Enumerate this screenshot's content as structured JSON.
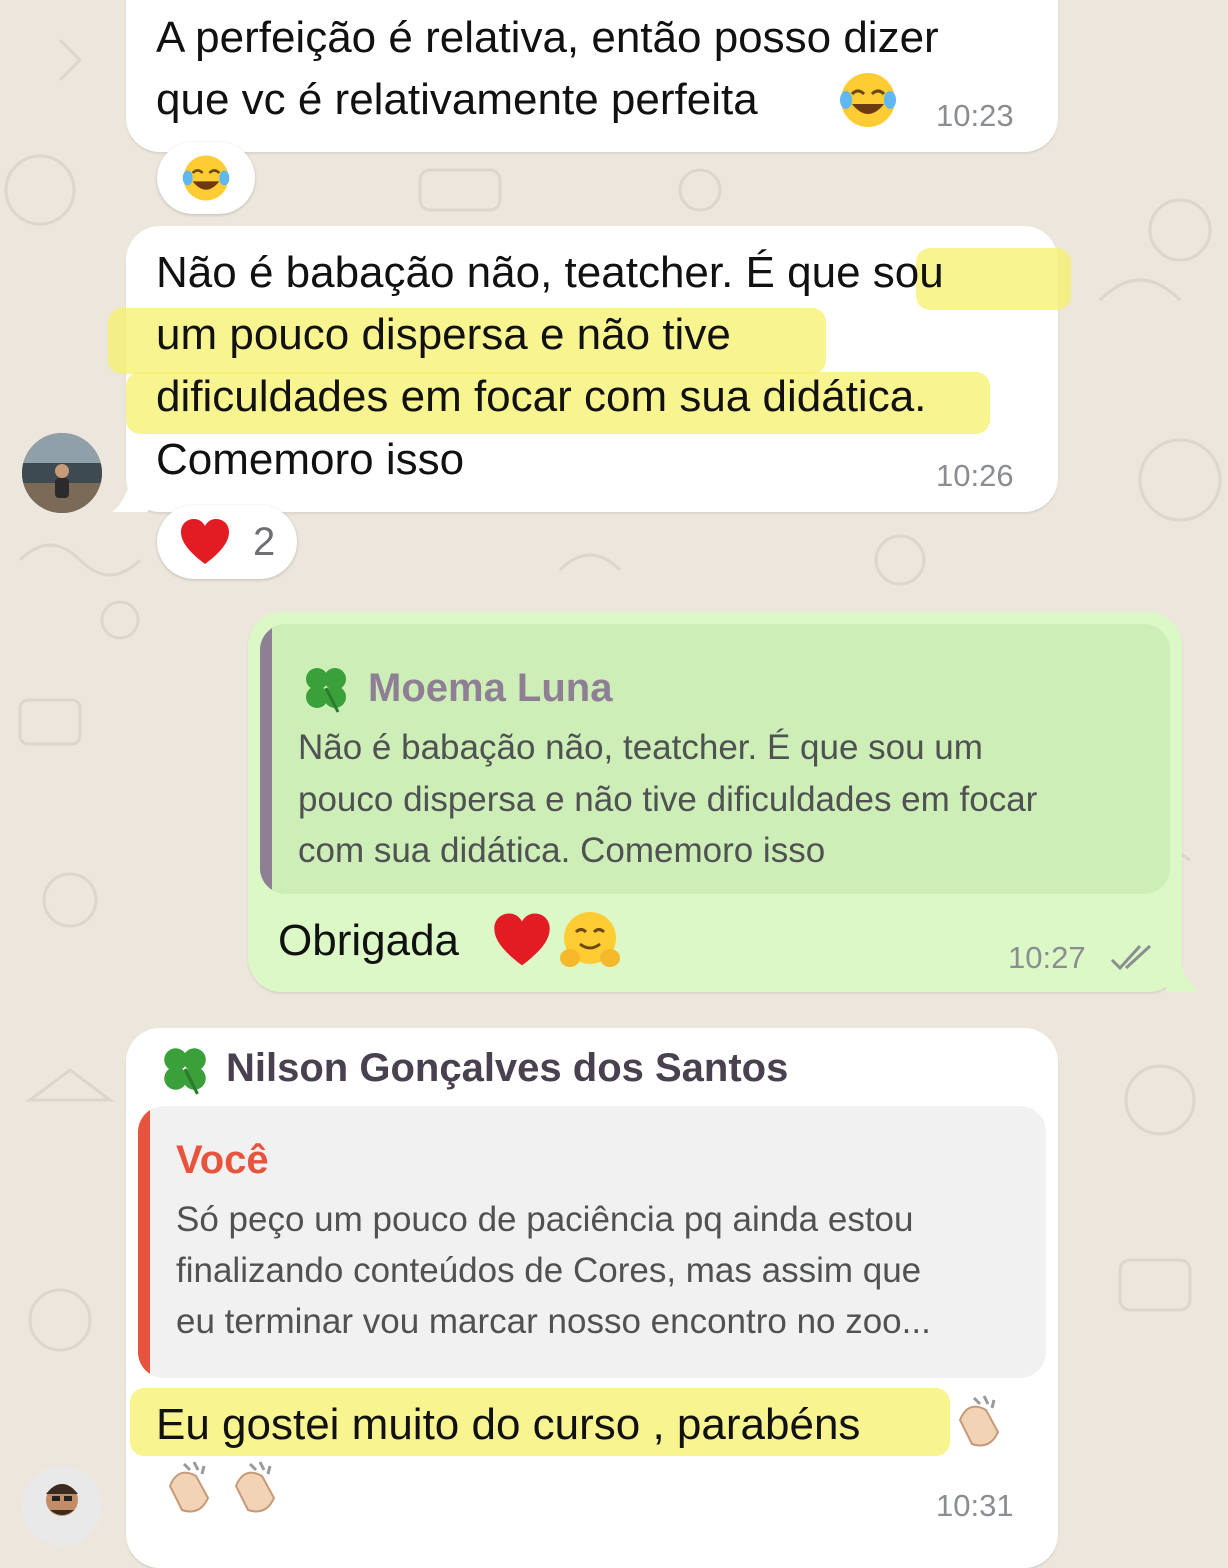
{
  "chat": {
    "messages": [
      {
        "line1": "A perfeição é relativa, então posso dizer",
        "line2": "que vc é relativamente perfeita",
        "time": "10:23",
        "reaction_emoji": "face-with-tears-of-joy"
      },
      {
        "line1a": "Não é babação não, teatcher. É que",
        "line1b": "sou",
        "line2": "um pouco dispersa e não tive",
        "line3a": "dificuldades em focar com sua didátic",
        "line3b": "a.",
        "line4": "Comemoro isso",
        "time": "10:26",
        "reaction_emoji": "red-heart",
        "reaction_count": "2"
      },
      {
        "quoted_author": "Moema Luna",
        "quoted_line1": "Não é babação não, teatcher. É que sou um",
        "quoted_line2": "pouco dispersa e não tive dificuldades em focar",
        "quoted_line3": "com sua didática. Comemoro isso",
        "text": "Obrigada",
        "time": "10:27",
        "status_icon": "double-check-icon"
      },
      {
        "sender": "Nilson Gonçalves dos Santos",
        "quoted_author": "Você",
        "quoted_line1": "Só peço um pouco de paciência pq ainda estou",
        "quoted_line2": "finalizando conteúdos de Cores, mas assim que",
        "quoted_line3": "eu terminar vou marcar nosso encontro no zoo...",
        "text": "Eu gostei muito do curso , parabéns",
        "time": "10:31"
      }
    ]
  },
  "colors": {
    "background": "#ece6dc",
    "incoming_bubble": "#ffffff",
    "outgoing_bubble": "#dcf8c6",
    "outgoing_quote": "#cdeeb6",
    "incoming_quote": "#f1f1f2",
    "quote_bar_moema": "#8e7f95",
    "quote_bar_voce": "#e8533d",
    "highlight": "#f6f06a"
  }
}
